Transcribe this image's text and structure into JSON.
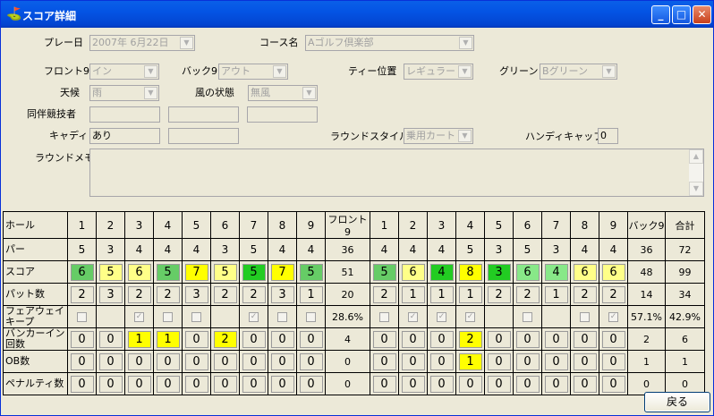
{
  "window": {
    "title": "スコア詳細"
  },
  "form": {
    "play_date_label": "プレー日",
    "play_date": "2007年 6月22日",
    "course_label": "コース名",
    "course": "Aゴルフ倶楽部",
    "front9_label": "フロント9",
    "front9": "イン",
    "back9_label": "バック9",
    "back9": "アウト",
    "tee_label": "ティー位置",
    "tee": "レギュラー",
    "green_label": "グリーン",
    "green": "Bグリーン",
    "weather_label": "天候",
    "weather": "雨",
    "wind_label": "風の状態",
    "wind": "無風",
    "companions_label": "同伴競技者",
    "caddie_label": "キャディ",
    "caddie": "あり",
    "round_style_label": "ラウンドスタイル",
    "round_style": "乗用カート",
    "handicap_label": "ハンディキャップ",
    "handicap": "0",
    "memo_label": "ラウンドメモ"
  },
  "colors": {
    "green": "#66cc66",
    "light_green": "#88e888",
    "dark_green": "#22cc22",
    "yellow": "#ffff00",
    "light_yellow": "#ffff88"
  },
  "table": {
    "row_labels": [
      "ホール",
      "パー",
      "スコア",
      "パット数",
      "フェアウェイキープ",
      "バンカーイン回数",
      "OB数",
      "ペナルティ数"
    ],
    "front_total_label": "フロント9",
    "back_total_label": "バック9",
    "grand_total_label": "合計",
    "holes_front": [
      "1",
      "2",
      "3",
      "4",
      "5",
      "6",
      "7",
      "8",
      "9"
    ],
    "holes_back": [
      "1",
      "2",
      "3",
      "4",
      "5",
      "6",
      "7",
      "8",
      "9"
    ],
    "par_front": [
      "5",
      "3",
      "4",
      "4",
      "4",
      "3",
      "5",
      "4",
      "4"
    ],
    "par_front_total": "36",
    "par_back": [
      "4",
      "4",
      "4",
      "5",
      "3",
      "5",
      "3",
      "4",
      "4"
    ],
    "par_back_total": "36",
    "par_total": "72",
    "score_front": [
      "6",
      "5",
      "6",
      "5",
      "7",
      "5",
      "5",
      "7",
      "5"
    ],
    "score_front_total": "51",
    "score_back": [
      "5",
      "6",
      "4",
      "8",
      "3",
      "6",
      "4",
      "6",
      "6"
    ],
    "score_back_total": "48",
    "score_total": "99",
    "putt_front": [
      "2",
      "3",
      "2",
      "2",
      "3",
      "2",
      "2",
      "3",
      "1"
    ],
    "putt_front_total": "20",
    "putt_back": [
      "2",
      "1",
      "1",
      "1",
      "2",
      "2",
      "1",
      "2",
      "2"
    ],
    "putt_back_total": "14",
    "putt_total": "34",
    "fairway_front": [
      false,
      null,
      true,
      false,
      false,
      null,
      true,
      false,
      false
    ],
    "fairway_front_total": "28.6%",
    "fairway_back": [
      false,
      true,
      true,
      true,
      null,
      false,
      null,
      false,
      true
    ],
    "fairway_back_total": "57.1%",
    "fairway_total": "42.9%",
    "bunker_front": [
      "0",
      "0",
      "1",
      "1",
      "0",
      "2",
      "0",
      "0",
      "0"
    ],
    "bunker_front_total": "4",
    "bunker_back": [
      "0",
      "0",
      "0",
      "2",
      "0",
      "0",
      "0",
      "0",
      "0"
    ],
    "bunker_back_total": "2",
    "bunker_total": "6",
    "ob_front": [
      "0",
      "0",
      "0",
      "0",
      "0",
      "0",
      "0",
      "0",
      "0"
    ],
    "ob_front_total": "0",
    "ob_back": [
      "0",
      "0",
      "0",
      "1",
      "0",
      "0",
      "0",
      "0",
      "0"
    ],
    "ob_back_total": "1",
    "ob_total": "1",
    "penalty_front": [
      "0",
      "0",
      "0",
      "0",
      "0",
      "0",
      "0",
      "0",
      "0"
    ],
    "penalty_front_total": "0",
    "penalty_back": [
      "0",
      "0",
      "0",
      "0",
      "0",
      "0",
      "0",
      "0",
      "0"
    ],
    "penalty_back_total": "0",
    "penalty_total": "0"
  },
  "buttons": {
    "back": "戻る"
  }
}
